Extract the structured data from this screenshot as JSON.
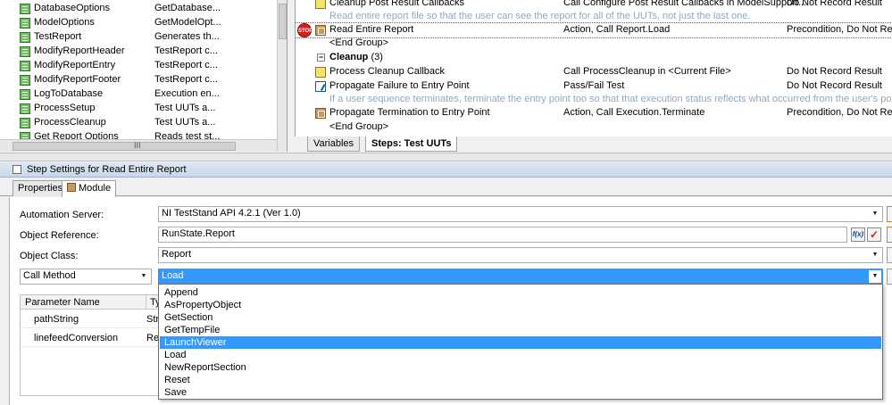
{
  "sequences": [
    {
      "name": "DatabaseOptions",
      "desc": "GetDatabase..."
    },
    {
      "name": "ModelOptions",
      "desc": "GetModelOpt..."
    },
    {
      "name": "TestReport",
      "desc": "Generates th..."
    },
    {
      "name": "ModifyReportHeader",
      "desc": "TestReport c..."
    },
    {
      "name": "ModifyReportEntry",
      "desc": "TestReport c..."
    },
    {
      "name": "ModifyReportFooter",
      "desc": "TestReport c..."
    },
    {
      "name": "LogToDatabase",
      "desc": "Execution en..."
    },
    {
      "name": "ProcessSetup",
      "desc": "Test UUTs a..."
    },
    {
      "name": "ProcessCleanup",
      "desc": "Test UUTs a..."
    },
    {
      "name": "Get Report Options",
      "desc": "Reads test st..."
    }
  ],
  "seq_scroll_grip": "III",
  "steps": {
    "row0": {
      "name": "Cleanup Post Result Callbacks",
      "desc": "Call Configure Post Result Callbacks in ModelSupport...",
      "settings": "Do Not Record Result"
    },
    "comment1": "Read entire report file so that the user can see the report for all of the UUTs, not just the last one.",
    "row2": {
      "name": "Read Entire Report",
      "desc": "Action,  Call Report.Load",
      "settings": "Precondition, Do Not Record Result"
    },
    "end_group_1": "<End Group>",
    "cleanup_group": {
      "label": "Cleanup",
      "count": "(3)",
      "expander": "−"
    },
    "row5": {
      "name": "Process Cleanup Callback",
      "desc": "Call ProcessCleanup in <Current File>",
      "settings": "Do Not Record Result"
    },
    "row6": {
      "name": "Propagate Failure to Entry Point",
      "desc": "Pass/Fail Test",
      "settings": "Do Not Record Result"
    },
    "comment7": "If a user sequence terminates, terminate the entry point too so that that execution status reflects what occurred from the user's point of view.",
    "row8": {
      "name": "Propagate Termination to Entry Point",
      "desc": "Action,  Call Execution.Terminate",
      "settings": "Precondition, Do Not Record Result"
    },
    "end_group_2": "<End Group>",
    "stop_badge": "STOP"
  },
  "steps_tabs": {
    "variables": "Variables",
    "steps": "Steps: Test UUTs"
  },
  "settings": {
    "title": "Step Settings for Read Entire Report",
    "tab_properties": "Properties",
    "tab_module": "Module",
    "automation_server_label": "Automation Server:",
    "automation_server_value": "NI TestStand API 4.2.1 (Ver 1.0)",
    "object_reference_label": "Object Reference:",
    "object_reference_value": "RunState.Report",
    "fx_label": "f(x)",
    "check_label": "✓",
    "object_class_label": "Object Class:",
    "object_class_value": "Report",
    "call_type_value": "Call Method",
    "method_value": "Load",
    "arrow_glyph": "▼",
    "param_headers": {
      "name": "Parameter Name",
      "type": "Ty"
    },
    "params": [
      {
        "name": "pathString",
        "type": "Str"
      },
      {
        "name": "linefeedConversion",
        "type": "Re"
      }
    ]
  },
  "dropdown": {
    "items": [
      "Append",
      "AsPropertyObject",
      "GetSection",
      "GetTempFile",
      "LaunchViewer",
      "Load",
      "NewReportSection",
      "Reset",
      "Save"
    ],
    "highlighted": "LaunchViewer"
  },
  "colors": {
    "selection": "#3399ff",
    "comment": "#8fa9c3",
    "title_bar": "#c9d7e8"
  }
}
